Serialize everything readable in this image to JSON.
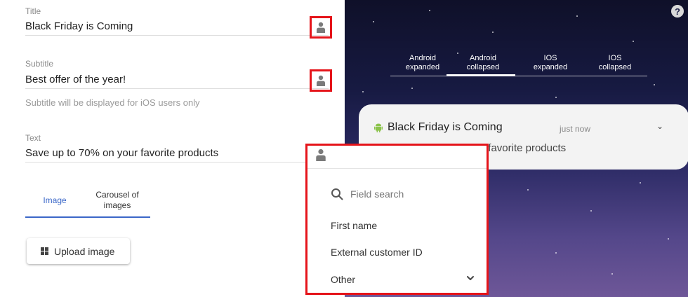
{
  "form": {
    "title_label": "Title",
    "title_value": "Black Friday is Coming",
    "subtitle_label": "Subtitle",
    "subtitle_value": "Best offer of the year!",
    "subtitle_hint": "Subtitle will be displayed for iOS users only",
    "text_label": "Text",
    "text_value": "Save up to 70% on your favorite products",
    "person_icon": "person-icon"
  },
  "media_tabs": {
    "image": "Image",
    "carousel_line1": "Carousel of",
    "carousel_line2": "images"
  },
  "upload": {
    "label": "Upload image",
    "icon": "grid-icon"
  },
  "preview": {
    "help_glyph": "?",
    "tabs": [
      {
        "line1": "Android",
        "line2": "expanded"
      },
      {
        "line1": "Android",
        "line2": "collapsed"
      },
      {
        "line1": "IOS",
        "line2": "expanded"
      },
      {
        "line1": "IOS",
        "line2": "collapsed"
      }
    ],
    "active_tab": "Android collapsed",
    "notification": {
      "title": "Black Friday is Coming",
      "time": "just now",
      "text": "Save up to 70% on your favorite products",
      "chevron": "⌄"
    }
  },
  "dropdown": {
    "search_placeholder": "Field search",
    "items": [
      "First name",
      "External customer ID",
      "Other"
    ]
  },
  "colors": {
    "accent": "#3a67c8",
    "highlight_box": "#e5141a",
    "android_green": "#8bc34a"
  }
}
